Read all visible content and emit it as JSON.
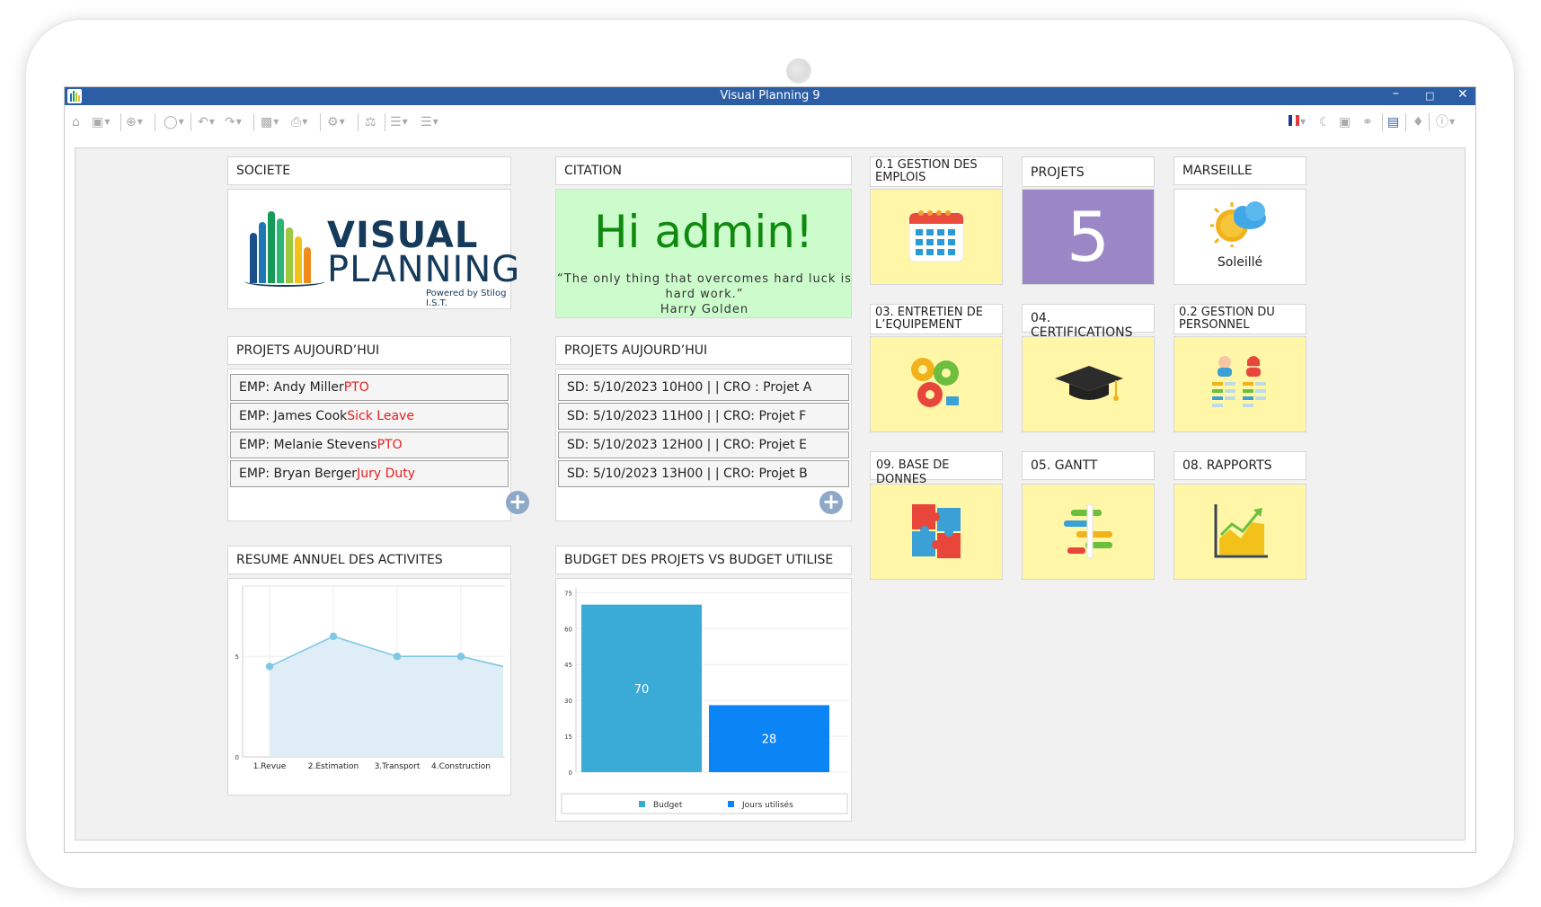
{
  "window": {
    "title": "Visual Planning 9"
  },
  "widgets": {
    "societe": {
      "title": "SOCIETE",
      "logo_line1": "VISUAL",
      "logo_line2": "PLANNING",
      "logo_tagline": "Powered by Stilog I.S.T."
    },
    "citation": {
      "title": "CITATION",
      "greeting": "Hi admin!",
      "quote": "“The only thing that overcomes hard luck is hard work.”",
      "author": "Harry Golden"
    },
    "projets_aujourdhui_emp": {
      "title": "PROJETS AUJOURD’HUI",
      "items": [
        {
          "name": "EMP: Andy Miller",
          "status": "PTO"
        },
        {
          "name": "EMP: James Cook",
          "status": "Sick Leave"
        },
        {
          "name": "EMP: Melanie Stevens",
          "status": "PTO"
        },
        {
          "name": "EMP: Bryan Berger",
          "status": "Jury Duty"
        }
      ]
    },
    "projets_aujourdhui_sd": {
      "title": "PROJETS AUJOURD’HUI",
      "items": [
        "SD: 5/10/2023 10H00 | | CRO : Projet A",
        "SD: 5/10/2023 11H00 | | CRO: Projet F",
        "SD: 5/10/2023 12H00 | | CRO: Projet E",
        "SD: 5/10/2023 13H00 | | CRO: Projet B"
      ]
    },
    "resume": {
      "title": "RESUME ANNUEL DES ACTIVITES"
    },
    "budget": {
      "title": "BUDGET DES PROJETS VS BUDGET UTILISE"
    },
    "tiles": {
      "gestion_emplois": {
        "title": "0.1 GESTION DES EMPLOIS",
        "icon": "calendar-icon"
      },
      "projets": {
        "title": "PROJETS",
        "value": "5"
      },
      "marseille": {
        "title": "MARSEILLE",
        "weather": "Soleillé",
        "icon": "sun-cloud-icon"
      },
      "entretien": {
        "title": "03. ENTRETIEN DE L’EQUIPEMENT",
        "icon": "gears-icon"
      },
      "certifications": {
        "title": "04. CERTIFICATIONS",
        "icon": "graduation-cap-icon"
      },
      "gestion_personnel": {
        "title": "0.2 GESTION DU PERSONNEL",
        "icon": "people-list-icon"
      },
      "base_donnes": {
        "title": "09. BASE DE DONNES",
        "icon": "puzzle-icon"
      },
      "gantt": {
        "title": "05. GANTT",
        "icon": "gantt-icon"
      },
      "rapports": {
        "title": "08. RAPPORTS",
        "icon": "growth-chart-icon"
      }
    }
  },
  "colors": {
    "titlebar": "#2b5ea5",
    "tile_yellow": "#fff6a8",
    "tile_purple": "#9b87c5",
    "quote_bg": "#ccfccc",
    "greeting": "#0f8a0f",
    "status_red": "#e52020",
    "line_series": "#7ec8e3",
    "bar_budget": "#3aabd6",
    "bar_jours": "#0b84f5"
  },
  "chart_data": [
    {
      "type": "area",
      "categories": [
        "1.Revue",
        "2.Estimation",
        "3.Transport",
        "4.Construction"
      ],
      "series": [
        {
          "values": [
            4.5,
            6,
            5,
            5
          ]
        }
      ],
      "yticks": [
        0,
        5
      ],
      "ylim": [
        0,
        8.5
      ],
      "grid": true
    },
    {
      "type": "bar",
      "categories": [
        ""
      ],
      "series": [
        {
          "name": "Budget",
          "values": [
            70
          ]
        },
        {
          "name": "Jours utilisés",
          "values": [
            28
          ]
        }
      ],
      "yticks": [
        0,
        15,
        30,
        45,
        60,
        75
      ],
      "ylim": [
        0,
        77
      ],
      "legend": "bottom",
      "grid": true
    }
  ]
}
